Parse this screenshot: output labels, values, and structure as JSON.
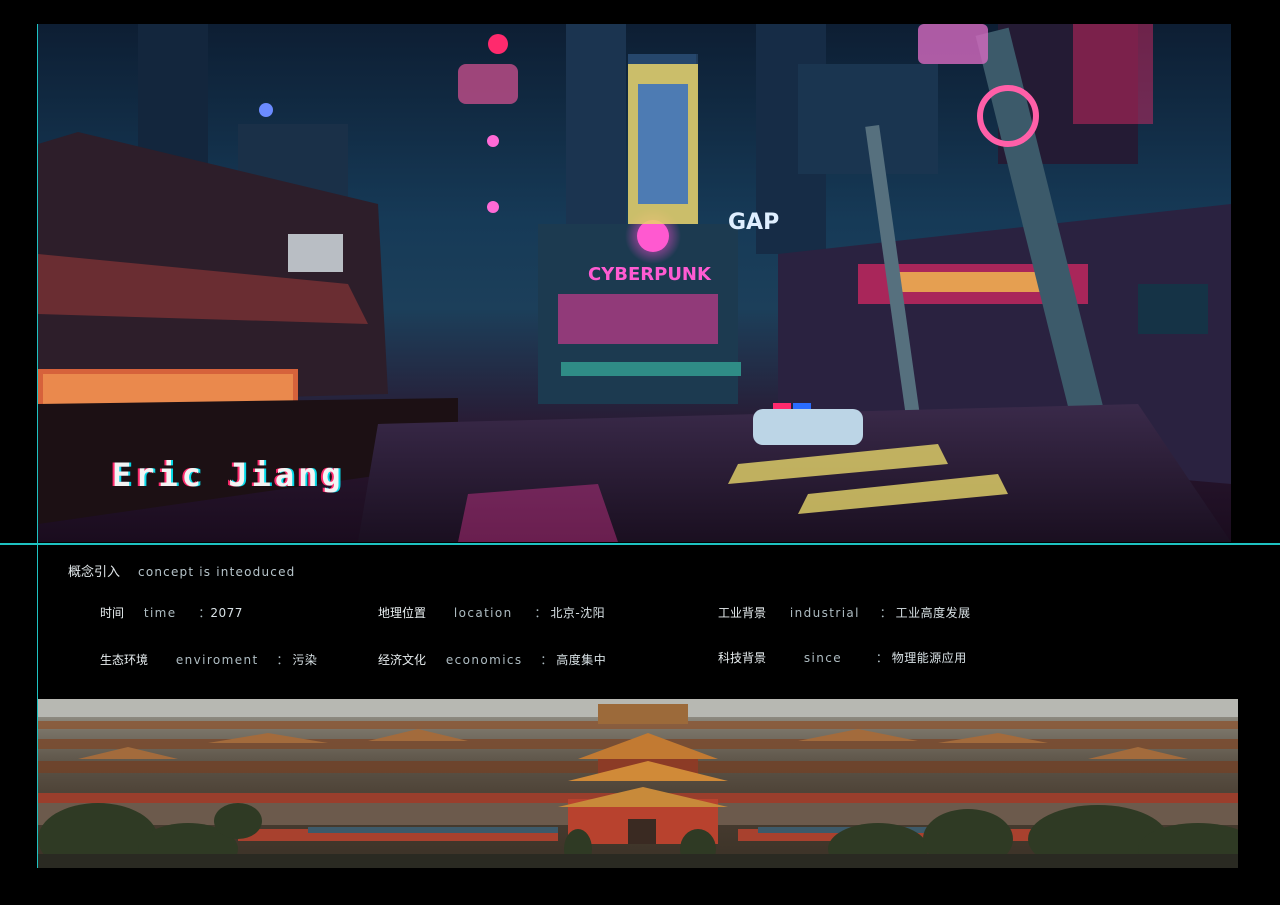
{
  "hero": {
    "title": "Eric Jiang",
    "signs": {
      "cyberpunk": "CYBERPUNK",
      "gap": "GAP"
    }
  },
  "section": {
    "title_cn": "概念引入",
    "title_en": "concept is inteoduced"
  },
  "fields": [
    {
      "label": "时间",
      "en": "time",
      "colon": "：",
      "value": "2077"
    },
    {
      "label": "地理位置",
      "en": "location",
      "colon": "：",
      "value": "北京-沈阳"
    },
    {
      "label": "工业背景",
      "en": "industrial",
      "colon": "：",
      "value": "工业高度发展"
    },
    {
      "label": "生态环境",
      "en": "enviroment",
      "colon": "：",
      "value": "污染"
    },
    {
      "label": "经济文化",
      "en": "economics",
      "colon": "：",
      "value": "高度集中"
    },
    {
      "label": "科技背景",
      "en": "since",
      "colon": "：",
      "value": "物理能源应用"
    }
  ],
  "colors": {
    "accent": "#1ec2c2",
    "neon_pink": "#ff2a9d",
    "neon_cyan": "#05d9e8"
  }
}
